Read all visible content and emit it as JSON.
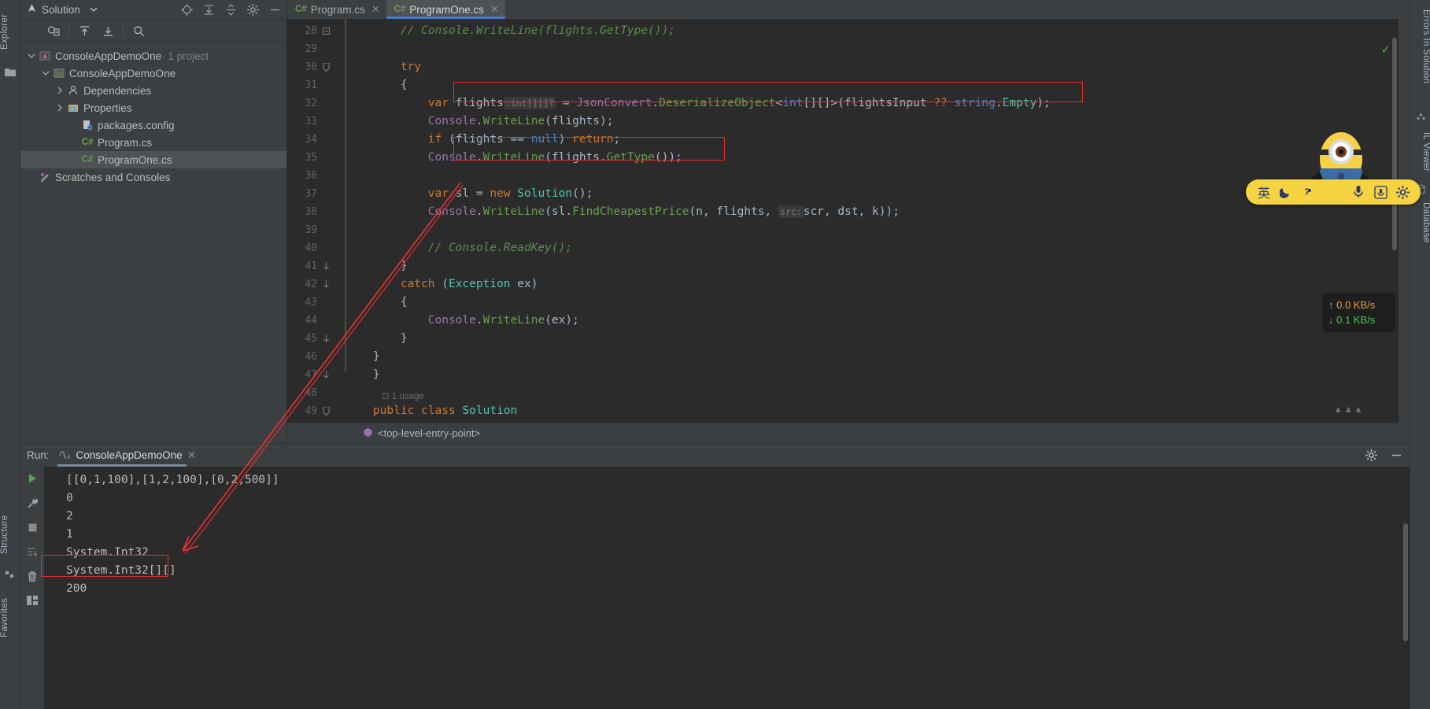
{
  "solution": {
    "title": "Solution",
    "dropdown_icon": "chevron-down-icon",
    "header_buttons": [
      "target-icon",
      "expand-all-icon",
      "collapse-all-icon",
      "settings-icon",
      "minimize-icon"
    ],
    "toolbar_buttons": [
      "show-all-files-icon",
      "export-icon",
      "import-icon",
      "search-icon"
    ],
    "tree": [
      {
        "label": "ConsoleAppDemoOne",
        "suffix": " · 1 project",
        "icon": "solution-icon",
        "indent": 0,
        "expanded": true,
        "selected": false
      },
      {
        "label": "ConsoleAppDemoOne",
        "suffix": "",
        "icon": "csproj-icon",
        "indent": 1,
        "expanded": true,
        "selected": false
      },
      {
        "label": "Dependencies",
        "suffix": "",
        "icon": "dependencies-icon",
        "indent": 2,
        "expanded": false,
        "selected": false
      },
      {
        "label": "Properties",
        "suffix": "",
        "icon": "properties-icon",
        "indent": 2,
        "expanded": false,
        "selected": false
      },
      {
        "label": "packages.config",
        "suffix": "",
        "icon": "config-icon",
        "indent": 3,
        "expanded": null,
        "selected": false
      },
      {
        "label": "Program.cs",
        "suffix": "",
        "icon": "csharp-icon",
        "indent": 3,
        "expanded": null,
        "selected": false
      },
      {
        "label": "ProgramOne.cs",
        "suffix": "",
        "icon": "csharp-icon",
        "indent": 3,
        "expanded": null,
        "selected": true
      },
      {
        "label": "Scratches and Consoles",
        "suffix": "",
        "icon": "scratches-icon",
        "indent": 0,
        "expanded": null,
        "selected": false
      }
    ]
  },
  "left_rail": {
    "tabs": [
      "Explorer",
      "Structure",
      "Favorites"
    ],
    "icons": [
      "folder-icon"
    ]
  },
  "right_rail": {
    "tabs": [
      "Errors In Solution",
      "IL Viewer",
      "Database"
    ]
  },
  "editor": {
    "tabs": [
      {
        "label": "Program.cs",
        "badge": "C#",
        "active": false
      },
      {
        "label": "ProgramOne.cs",
        "badge": "C#",
        "active": true
      }
    ],
    "breadcrumb": "<top-level-entry-point>",
    "first_line": 28,
    "lines": [
      {
        "n": 28,
        "fold": "minus",
        "segments": [
          {
            "t": "        // Console.WriteLine(flights.GetType());",
            "c": "cmt"
          }
        ]
      },
      {
        "n": 29,
        "fold": "",
        "segments": []
      },
      {
        "n": 30,
        "fold": "tri",
        "segments": [
          {
            "t": "        ",
            "c": "txt"
          },
          {
            "t": "try",
            "c": "k"
          }
        ]
      },
      {
        "n": 31,
        "fold": "",
        "segments": [
          {
            "t": "        {",
            "c": "txt"
          }
        ]
      },
      {
        "n": 32,
        "fold": "",
        "segments": [
          {
            "t": "            ",
            "c": "txt"
          },
          {
            "t": "var",
            "c": "k"
          },
          {
            "t": " flights",
            "c": "txt"
          },
          {
            "t": ":int[][]?",
            "c": "hint"
          },
          {
            "t": " = ",
            "c": "txt"
          },
          {
            "t": "JsonConvert",
            "c": "pur"
          },
          {
            "t": ".",
            "c": "txt"
          },
          {
            "t": "DeserializeObject",
            "c": "mth"
          },
          {
            "t": "<",
            "c": "txt"
          },
          {
            "t": "int",
            "c": "kb"
          },
          {
            "t": "[][]>(flightsInput ",
            "c": "txt"
          },
          {
            "t": "??",
            "c": "k"
          },
          {
            "t": " ",
            "c": "txt"
          },
          {
            "t": "string",
            "c": "kb"
          },
          {
            "t": ".",
            "c": "txt"
          },
          {
            "t": "Empty",
            "c": "cls"
          },
          {
            "t": ");",
            "c": "txt"
          }
        ]
      },
      {
        "n": 33,
        "fold": "",
        "segments": [
          {
            "t": "            ",
            "c": "txt"
          },
          {
            "t": "Console",
            "c": "pur"
          },
          {
            "t": ".",
            "c": "txt"
          },
          {
            "t": "WriteLine",
            "c": "mth"
          },
          {
            "t": "(flights);",
            "c": "txt"
          }
        ]
      },
      {
        "n": 34,
        "fold": "",
        "segments": [
          {
            "t": "            ",
            "c": "txt"
          },
          {
            "t": "if",
            "c": "k"
          },
          {
            "t": " (flights == ",
            "c": "txt"
          },
          {
            "t": "null",
            "c": "kb"
          },
          {
            "t": ") ",
            "c": "txt"
          },
          {
            "t": "return",
            "c": "k"
          },
          {
            "t": ";",
            "c": "txt"
          }
        ]
      },
      {
        "n": 35,
        "fold": "",
        "segments": [
          {
            "t": "            ",
            "c": "txt"
          },
          {
            "t": "Console",
            "c": "pur"
          },
          {
            "t": ".",
            "c": "txt"
          },
          {
            "t": "WriteLine",
            "c": "mth"
          },
          {
            "t": "(flights.",
            "c": "txt"
          },
          {
            "t": "GetType",
            "c": "mth"
          },
          {
            "t": "());",
            "c": "txt"
          }
        ]
      },
      {
        "n": 36,
        "fold": "",
        "segments": []
      },
      {
        "n": 37,
        "fold": "",
        "segments": [
          {
            "t": "            ",
            "c": "txt"
          },
          {
            "t": "var",
            "c": "k"
          },
          {
            "t": " sl = ",
            "c": "txt"
          },
          {
            "t": "new",
            "c": "k"
          },
          {
            "t": " ",
            "c": "txt"
          },
          {
            "t": "Solution",
            "c": "cls"
          },
          {
            "t": "();",
            "c": "txt"
          }
        ]
      },
      {
        "n": 38,
        "fold": "",
        "segments": [
          {
            "t": "            ",
            "c": "txt"
          },
          {
            "t": "Console",
            "c": "pur"
          },
          {
            "t": ".",
            "c": "txt"
          },
          {
            "t": "WriteLine",
            "c": "mth"
          },
          {
            "t": "(sl.",
            "c": "txt"
          },
          {
            "t": "FindCheapestPrice",
            "c": "mth"
          },
          {
            "t": "(n, flights, ",
            "c": "txt"
          },
          {
            "t": "src:",
            "c": "hint"
          },
          {
            "t": "scr, dst, k));",
            "c": "txt"
          }
        ]
      },
      {
        "n": 39,
        "fold": "",
        "segments": []
      },
      {
        "n": 40,
        "fold": "",
        "segments": [
          {
            "t": "            // Console.ReadKey();",
            "c": "cmt"
          }
        ]
      },
      {
        "n": 41,
        "fold": "brace",
        "segments": [
          {
            "t": "        }",
            "c": "txt"
          }
        ]
      },
      {
        "n": 42,
        "fold": "brace",
        "segments": [
          {
            "t": "        ",
            "c": "txt"
          },
          {
            "t": "catch",
            "c": "k"
          },
          {
            "t": " (",
            "c": "txt"
          },
          {
            "t": "Exception",
            "c": "cls"
          },
          {
            "t": " ex)",
            "c": "txt"
          }
        ]
      },
      {
        "n": 43,
        "fold": "",
        "segments": [
          {
            "t": "        {",
            "c": "txt"
          }
        ]
      },
      {
        "n": 44,
        "fold": "",
        "segments": [
          {
            "t": "            ",
            "c": "txt"
          },
          {
            "t": "Console",
            "c": "pur"
          },
          {
            "t": ".",
            "c": "txt"
          },
          {
            "t": "WriteLine",
            "c": "mth"
          },
          {
            "t": "(ex);",
            "c": "txt"
          }
        ]
      },
      {
        "n": 45,
        "fold": "brace",
        "segments": [
          {
            "t": "        }",
            "c": "txt"
          }
        ]
      },
      {
        "n": 46,
        "fold": "",
        "segments": [
          {
            "t": "    }",
            "c": "txt"
          }
        ]
      },
      {
        "n": 47,
        "fold": "brace",
        "segments": [
          {
            "t": "    }",
            "c": "txt"
          }
        ]
      },
      {
        "n": 48,
        "fold": "",
        "segments": []
      },
      {
        "n": 49,
        "fold": "tri",
        "segments": [
          {
            "t": "    ",
            "c": "txt"
          },
          {
            "t": "public",
            "c": "k"
          },
          {
            "t": " ",
            "c": "txt"
          },
          {
            "t": "class",
            "c": "k"
          },
          {
            "t": " ",
            "c": "txt"
          },
          {
            "t": "Solution",
            "c": "cls"
          }
        ]
      }
    ],
    "usage_hint": "1 usage",
    "status_check": "✓"
  },
  "run_panel": {
    "label": "Run:",
    "tab_label": "ConsoleAppDemoOne",
    "tab_icon": "run-config-icon",
    "close_icon": "close-icon",
    "settings_icon": "gear-icon",
    "minimize_icon": "minimize-icon",
    "rail_buttons": [
      "rerun-icon",
      "wrench-icon",
      "stop-icon",
      "soft-wrap-icon",
      "trash-icon",
      "layout-icon"
    ],
    "console_lines": [
      "[[0,1,100],[1,2,100],[0,2,500]]",
      "0",
      "2",
      "1",
      "System.Int32",
      "System.Int32[][]",
      "200"
    ]
  },
  "network_widget": {
    "upload": "0.0 KB/s",
    "download": "0.1 KB/s",
    "upload_arrow": "arrow-up-icon",
    "download_arrow": "arrow-down-icon",
    "upload_color": "#e8a33d",
    "download_color": "#4fc64f"
  },
  "ime_bar": {
    "mode": "英",
    "items": [
      "moon-icon",
      "comma-icon",
      "microphone-icon",
      "voice-input-icon",
      "settings-icon"
    ],
    "background": "#f5d341"
  },
  "annotation": {
    "color": "#e03030",
    "boxes": [
      "line32-highlight",
      "line35-highlight",
      "console-int32-array-highlight"
    ],
    "arrow": "red-arrow-from-code-to-console"
  }
}
